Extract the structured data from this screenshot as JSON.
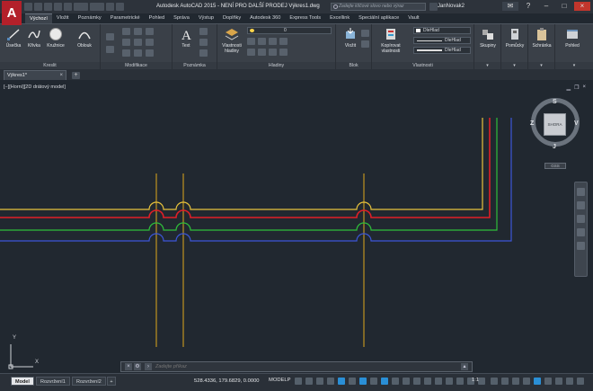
{
  "app": {
    "logo_letter": "A",
    "title": "Autodesk AutoCAD 2015 - NENÍ PRO DALŠÍ PRODEJ    Výkres1.dwg",
    "search_placeholder": "Zadejte klíčové slovo nebo výraz",
    "user": "JanNovak2"
  },
  "ribbon_tabs": [
    "Výchozí",
    "Vložit",
    "Poznámky",
    "Parametrické",
    "Pohled",
    "Správa",
    "Výstup",
    "Doplňky",
    "Autodesk 360",
    "Express Tools",
    "Excellink",
    "Speciální aplikace",
    "Vault"
  ],
  "ribbon": {
    "draw": {
      "line": "Úsečka",
      "polyline": "Křivka",
      "circle": "Kružnice",
      "arc": "Oblouk",
      "label": "Kreslit"
    },
    "modify": {
      "label": "Modifikace"
    },
    "annotation": {
      "text": "Text",
      "label": "Poznámka"
    },
    "layers": {
      "properties": "Vlastnosti hladiny",
      "current_layer": "0",
      "label": "Hladiny"
    },
    "block": {
      "insert": "Vložit",
      "label": "Blok"
    },
    "properties": {
      "match": "Kopírovat vlastnosti",
      "color": "DleHlad",
      "linetype": "DleHlad",
      "lineweight": "DleHlad",
      "label": "Vlastnosti"
    },
    "groups": {
      "label": "Skupiny"
    },
    "utilities": {
      "label": "Pomůcky"
    },
    "clipboard": {
      "label": "Schránka"
    },
    "view": {
      "label": "Pohled"
    }
  },
  "file_tab": {
    "name": "Výkres1*",
    "close": "×",
    "add": "+"
  },
  "viewport": {
    "label": "[−][Horní][2D drátový model]",
    "controls": [
      "▁",
      "❐",
      "×"
    ]
  },
  "viewcube": {
    "face": "SHORA",
    "north": "S",
    "south": "J",
    "east": "V",
    "west": "Z",
    "wcs": "GSS"
  },
  "ucs": {
    "x": "X",
    "y": "Y"
  },
  "command_line": {
    "placeholder": "Zadejte příkaz",
    "btn_close": "×",
    "btn_settings": "⚙"
  },
  "status": {
    "layout_tabs": [
      "Model",
      "Rozvržení1",
      "Rozvržení2"
    ],
    "coords": "528.4336, 179.6829, 0.0000",
    "space": "MODELP",
    "scale": "1:1"
  },
  "colors": {
    "yellow": "#e8c33c",
    "red": "#e01f27",
    "green": "#2fbe3a",
    "blue": "#3c56d8",
    "orange_vertical": "#e0a81c"
  }
}
